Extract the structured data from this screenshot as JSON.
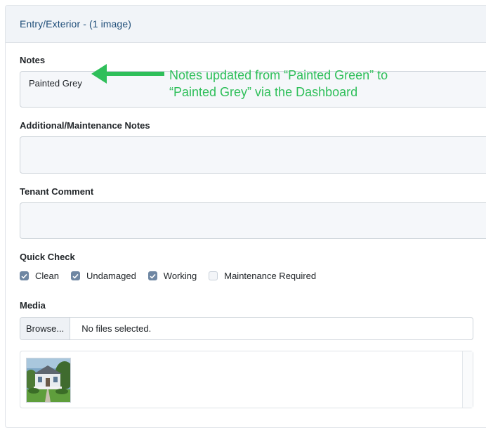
{
  "section": {
    "title": "Entry/Exterior - (1 image)"
  },
  "notes": {
    "label": "Notes",
    "value": "Painted Grey"
  },
  "annotation": {
    "line1": "Notes updated from “Painted Green” to",
    "line2": "“Painted Grey” via the Dashboard",
    "color": "#2fbf5a"
  },
  "maintenance_notes": {
    "label": "Additional/Maintenance Notes",
    "value": ""
  },
  "tenant_comment": {
    "label": "Tenant Comment",
    "value": ""
  },
  "quick_check": {
    "label": "Quick Check",
    "items": [
      {
        "label": "Clean",
        "checked": true
      },
      {
        "label": "Undamaged",
        "checked": true
      },
      {
        "label": "Working",
        "checked": true
      },
      {
        "label": "Maintenance Required",
        "checked": false
      }
    ]
  },
  "media": {
    "label": "Media",
    "browse_label": "Browse...",
    "file_status": "No files selected."
  }
}
